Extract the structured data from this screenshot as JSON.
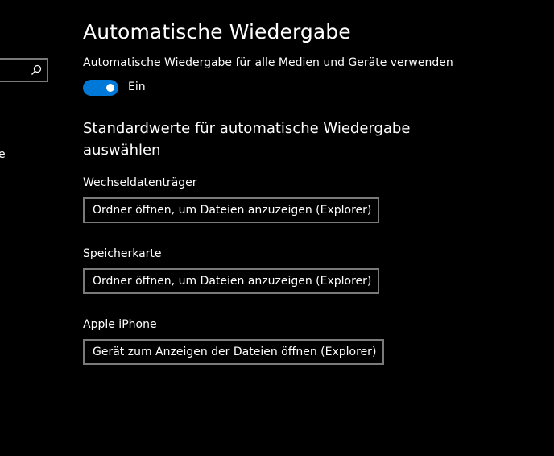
{
  "sidebar": {
    "search": {
      "placeholder": ""
    },
    "visible_fragment": "e"
  },
  "page": {
    "title": "Automatische Wiedergabe"
  },
  "autoplay": {
    "label": "Automatische Wiedergabe für alle Medien und Geräte verwenden",
    "enabled": true,
    "state_label": "Ein"
  },
  "defaults": {
    "title": "Standardwerte für automatische Wiedergabe auswählen",
    "fields": [
      {
        "label": "Wechseldatenträger",
        "value": "Ordner öffnen, um Dateien anzuzeigen (Explorer)"
      },
      {
        "label": "Speicherkarte",
        "value": "Ordner öffnen, um Dateien anzuzeigen (Explorer)"
      },
      {
        "label": "Apple iPhone",
        "value": "Gerät zum Anzeigen der Dateien öffnen (Explorer)"
      }
    ]
  },
  "colors": {
    "background": "#000000",
    "accent": "#0078d7",
    "border": "#7a7a7a",
    "text": "#ffffff"
  }
}
